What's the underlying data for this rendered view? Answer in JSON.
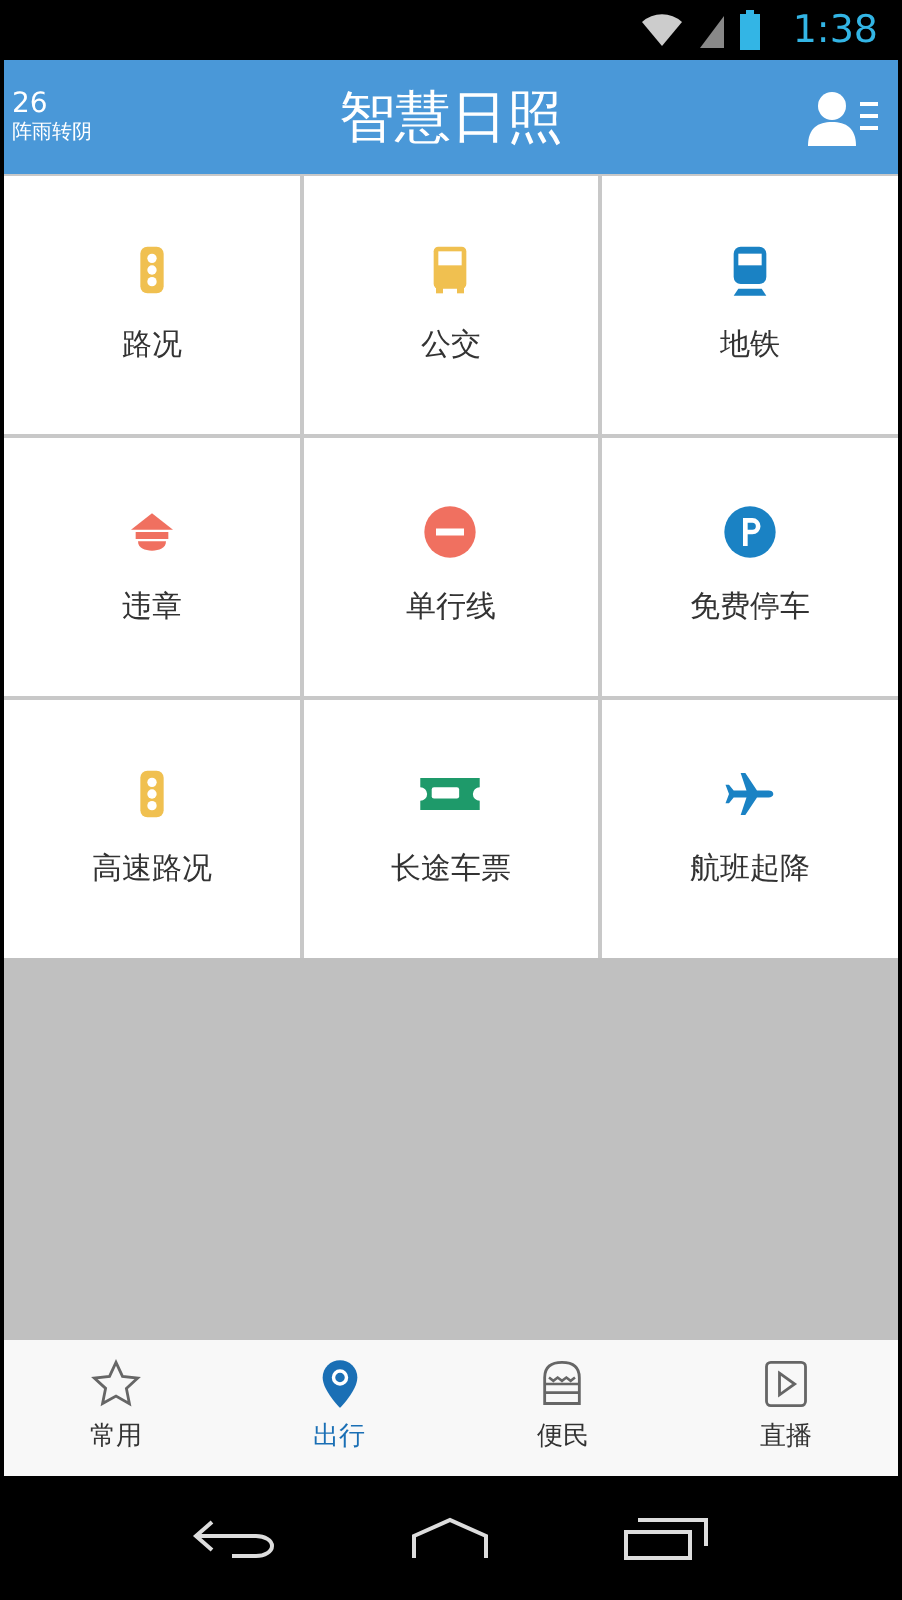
{
  "status_bar": {
    "time": "1:38"
  },
  "header": {
    "temperature": "26",
    "weather": "阵雨转阴",
    "title": "智慧日照"
  },
  "tiles": [
    {
      "label": "路况"
    },
    {
      "label": "公交"
    },
    {
      "label": "地铁"
    },
    {
      "label": "违章"
    },
    {
      "label": "单行线"
    },
    {
      "label": "免费停车"
    },
    {
      "label": "高速路况"
    },
    {
      "label": "长途车票"
    },
    {
      "label": "航班起降"
    }
  ],
  "tabs": [
    {
      "label": "常用",
      "selected": false
    },
    {
      "label": "出行",
      "selected": true
    },
    {
      "label": "便民",
      "selected": false
    },
    {
      "label": "直播",
      "selected": false
    }
  ]
}
